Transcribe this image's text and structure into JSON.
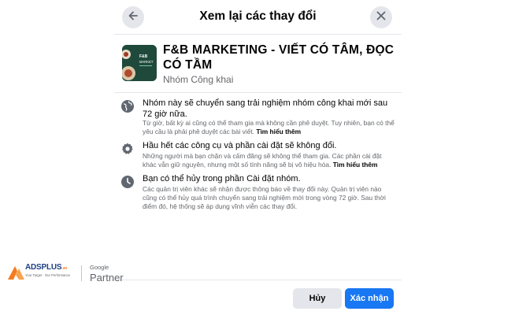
{
  "header": {
    "title": "Xem lại các thay đổi"
  },
  "group": {
    "name": "F&B MARKETING - VIẾT CÓ TÂM, ĐỌC CÓ TẦM",
    "privacy": "Nhóm Công khai",
    "thumb_text": "F&B MARKET"
  },
  "info_items": [
    {
      "icon": "globe-icon",
      "title": "Nhóm này sẽ chuyển sang trải nghiệm nhóm công khai mới sau 72 giờ nữa.",
      "desc": "Từ giờ, bất kỳ ai cũng có thể tham gia mà không cần phê duyệt. Tuy nhiên, bạn có thể yêu cầu là phải phê duyệt các bài viết.",
      "more": "Tìm hiểu thêm"
    },
    {
      "icon": "gear-icon",
      "title": "Hầu hết các công cụ và phần cài đặt sẽ không đổi.",
      "desc": "Những người mà bạn chặn và cấm đăng sẽ không thể tham gia. Các phần cài đặt khác vẫn giữ nguyên, nhưng một số tính năng sẽ bị vô hiệu hóa.",
      "more": "Tìm hiểu thêm"
    },
    {
      "icon": "clock-icon",
      "title": "Bạn có thể hủy trong phần Cài đặt nhóm.",
      "desc": "Các quản trị viên khác sẽ nhận được thông báo về thay đổi này. Quản trị viên nào cũng có thể hủy quá trình chuyển sang trải nghiệm mới trong vòng 72 giờ. Sau thời điểm đó, hệ thống sẽ áp dụng vĩnh viễn các thay đổi.",
      "more": ""
    }
  ],
  "buttons": {
    "cancel": "Hủy",
    "confirm": "Xác nhận"
  },
  "watermark": {
    "brand": "ADSPLUS",
    "brand_suffix": ".vn",
    "tagline": "Your Target · Our Performance",
    "google": "Google",
    "partner": "Partner"
  },
  "colors": {
    "primary": "#1877f2",
    "secondary_button": "#e4e6eb",
    "muted_text": "#65676b"
  }
}
